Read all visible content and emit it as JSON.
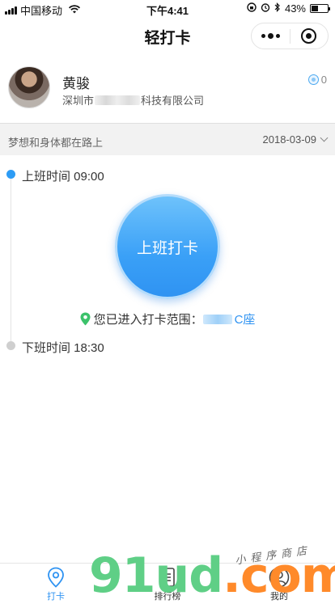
{
  "status_bar": {
    "carrier": "中国移动",
    "time": "下午4:41",
    "battery": "43%",
    "battery_level": 0.43
  },
  "nav": {
    "title": "轻打卡"
  },
  "profile": {
    "name": "黄骏",
    "company_prefix": "深圳市",
    "company_suffix": "科技有限公司",
    "points": "0"
  },
  "motto_bar": {
    "motto": "梦想和身体都在路上",
    "date": "2018-03-09"
  },
  "timeline": {
    "work_start": "上班时间 09:00",
    "work_end": "下班时间 18:30",
    "clock_button": "上班打卡",
    "range_text": "您已进入打卡范围：",
    "range_place": "C座"
  },
  "tabbar": {
    "tabs": [
      {
        "label": "打卡",
        "icon": "location-pin-icon",
        "active": true
      },
      {
        "label": "排行榜",
        "icon": "list-icon",
        "active": false
      },
      {
        "label": "我的",
        "icon": "user-icon",
        "active": false
      }
    ]
  },
  "watermark": {
    "logo_text": "91ud.com",
    "tagline": "小程序商店"
  },
  "colors": {
    "accent": "#2f93f2",
    "pin_green": "#3cc26b",
    "logo_green": "#5fcf86",
    "logo_orange": "#ff8a2a"
  }
}
